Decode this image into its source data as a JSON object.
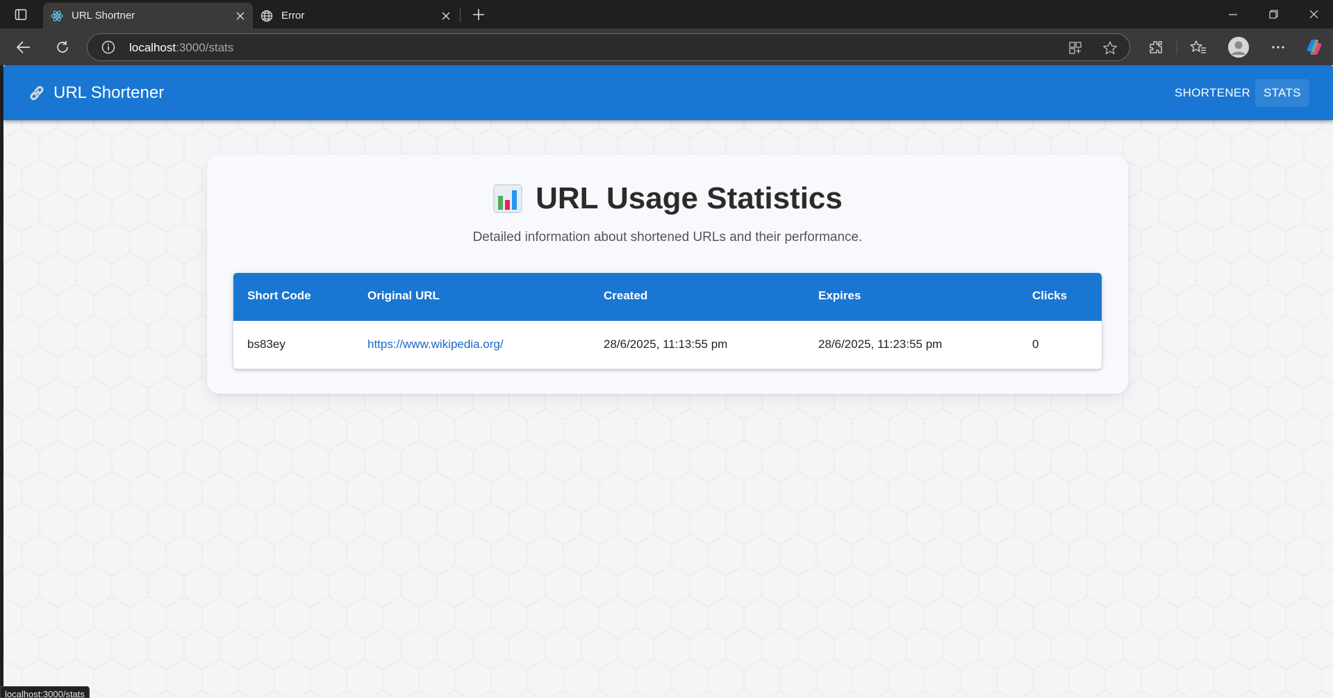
{
  "browser": {
    "tabs": [
      {
        "title": "URL Shortner",
        "icon": "react-icon",
        "active": true
      },
      {
        "title": "Error",
        "icon": "globe-icon",
        "active": false
      }
    ],
    "address": {
      "host": "localhost",
      "rest": ":3000/stats"
    },
    "status_url": "localhost:3000/stats"
  },
  "app": {
    "brand": "URL Shortener",
    "brand_icon": "link-icon",
    "nav": [
      {
        "label": "SHORTENER",
        "active": false
      },
      {
        "label": "STATS",
        "active": true
      }
    ],
    "accent": "#1976d2"
  },
  "stats": {
    "title": "URL Usage Statistics",
    "title_icon": "bar-chart-icon",
    "subtitle": "Detailed information about shortened URLs and their performance.",
    "columns": [
      "Short Code",
      "Original URL",
      "Created",
      "Expires",
      "Clicks"
    ],
    "rows": [
      [
        "bs83ey",
        "https://www.wikipedia.org/",
        "28/6/2025, 11:13:55 pm",
        "28/6/2025, 11:23:55 pm",
        "0"
      ]
    ]
  }
}
